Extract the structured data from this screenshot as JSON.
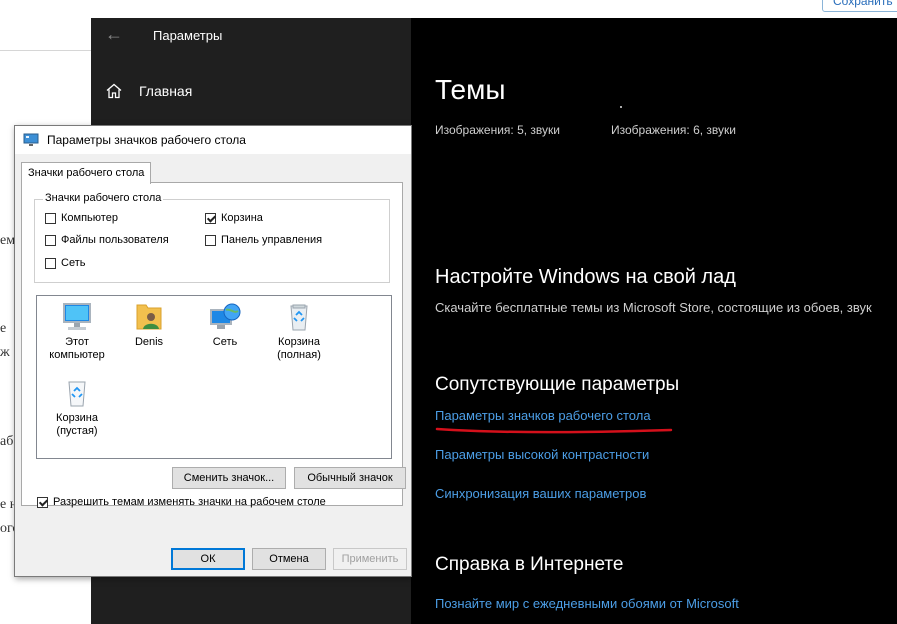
{
  "background_page": {
    "save_button_label": "Сохранить",
    "fragments": [
      "ем",
      "е",
      "ж",
      "аб",
      "е н",
      "ого"
    ]
  },
  "settings": {
    "window_title": "Параметры",
    "nav": {
      "home_label": "Главная"
    },
    "main": {
      "title": "Темы",
      "theme_captions": [
        "Изображения: 5, звуки",
        "Изображения: 6, звуки"
      ],
      "customize_heading": "Настройте Windows на свой лад",
      "customize_text": "Скачайте бесплатные темы из Microsoft Store, состоящие из обоев, звук",
      "related_heading": "Сопутствующие параметры",
      "related_links": [
        "Параметры значков рабочего стола",
        "Параметры высокой контрастности",
        "Синхронизация ваших параметров"
      ],
      "help_heading": "Справка в Интернете",
      "help_links": [
        "Познайте мир с ежедневными обоями от Microsoft"
      ]
    }
  },
  "dialog": {
    "title": "Параметры значков рабочего стола",
    "tab_label": "Значки рабочего стола",
    "group_label": "Значки рабочего стола",
    "checkboxes": [
      {
        "label": "Компьютер",
        "checked": false
      },
      {
        "label": "Корзина",
        "checked": true
      },
      {
        "label": "Файлы пользователя",
        "checked": false
      },
      {
        "label": "Панель управления",
        "checked": false
      },
      {
        "label": "Сеть",
        "checked": false
      }
    ],
    "icons": [
      {
        "label": "Этот компьютер",
        "icon": "computer-icon"
      },
      {
        "label": "Denis",
        "icon": "user-folder-icon"
      },
      {
        "label": "Сеть",
        "icon": "network-icon"
      },
      {
        "label": "Корзина (полная)",
        "icon": "recycle-bin-full-icon"
      },
      {
        "label": "Корзина (пустая)",
        "icon": "recycle-bin-empty-icon"
      }
    ],
    "change_icon_label": "Сменить значок...",
    "default_icon_label": "Обычный значок",
    "allow_themes": {
      "label": "Разрешить темам изменять значки на рабочем столе",
      "checked": true
    },
    "ok_label": "ОК",
    "cancel_label": "Отмена",
    "apply_label": "Применить"
  },
  "colors": {
    "link": "#4c9ee6",
    "annotation_underline": "#d4101b",
    "settings_sidebar": "#1f1f1f",
    "settings_main": "#000000",
    "dialog_accent": "#0078d7"
  }
}
